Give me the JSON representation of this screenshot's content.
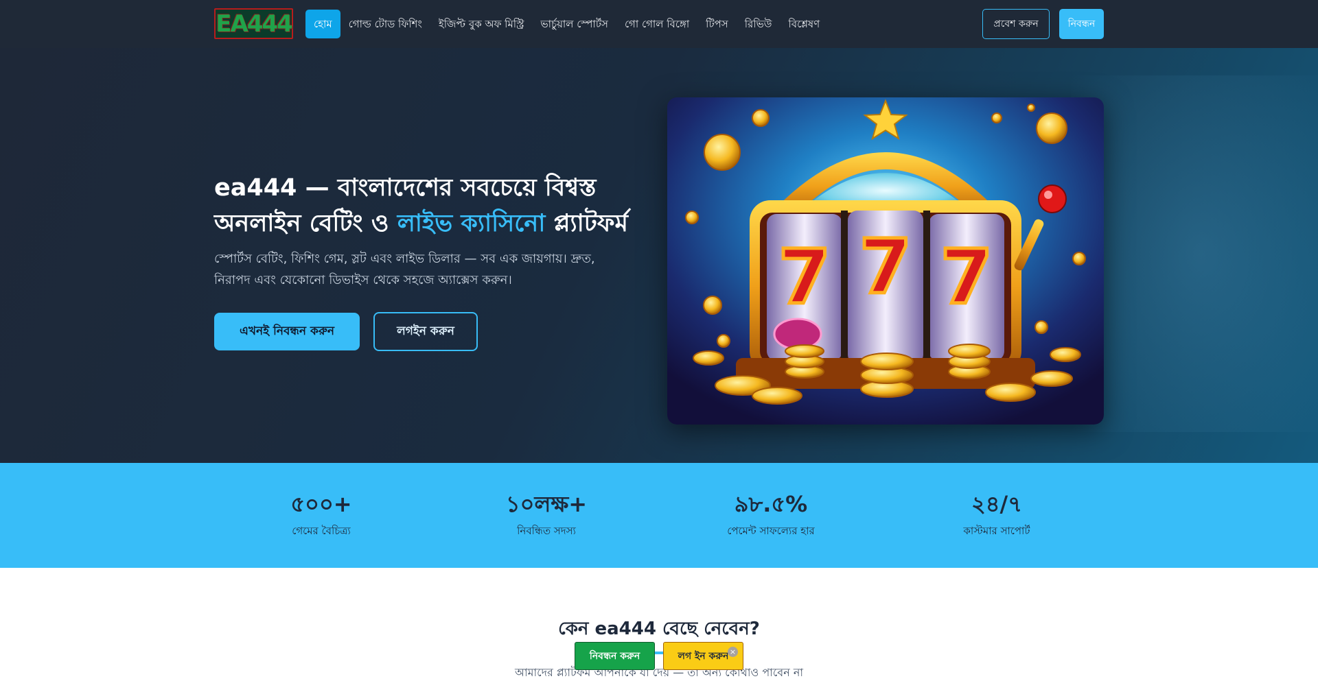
{
  "nav": {
    "logo_text": "EA444",
    "links": [
      {
        "label": "হোম",
        "active": true
      },
      {
        "label": "গোল্ড টোড ফিশিং",
        "active": false
      },
      {
        "label": "ইজিপ্ট বুক অফ মিস্ট্রি",
        "active": false
      },
      {
        "label": "ভার্চুয়াল স্পোর্টস",
        "active": false
      },
      {
        "label": "গো গোল বিঙ্গো",
        "active": false
      },
      {
        "label": "টিপস",
        "active": false
      },
      {
        "label": "রিভিউ",
        "active": false
      },
      {
        "label": "বিশ্লেষণ",
        "active": false
      }
    ],
    "login_label": "প্রবেশ করুন",
    "register_label": "নিবন্ধন"
  },
  "hero": {
    "title_part1": "ea444 — বাংলাদেশের সবচেয়ে বিশ্বস্ত অনলাইন বেটিং ও ",
    "title_accent": "লাইভ ক্যাসিনো",
    "title_part2": " প্ল্যাটফর্ম",
    "subtitle": "স্পোর্টস বেটিং, ফিশিং গেম, স্লট এবং লাইভ ডিলার — সব এক জায়গায়। দ্রুত, নিরাপদ এবং যেকোনো ডিভাইস থেকে সহজে অ্যাক্সেস করুন।",
    "primary_button": "এখনই নিবন্ধন করুন",
    "secondary_button": "লগইন করুন",
    "image_icon": "slot-machine-777-illustration"
  },
  "stats": [
    {
      "value": "৫০০+",
      "label": "গেমের বৈচিত্র্য"
    },
    {
      "value": "১০লক্ষ+",
      "label": "নিবন্ধিত সদস্য"
    },
    {
      "value": "৯৮.৫%",
      "label": "পেমেন্ট সাফল্যের হার"
    },
    {
      "value": "২৪/৭",
      "label": "কাস্টমার সাপোর্ট"
    }
  ],
  "why": {
    "title": "কেন ea444 বেছে নেবেন?",
    "subtitle": "আমাদের প্ল্যাটফর্ম আপনাকে যা দেয় — তা অন্য কোথাও পাবেন না"
  },
  "floating": {
    "register_label": "নিবন্ধন করুন",
    "login_label": "লগ ইন করুন",
    "close_symbol": "×"
  },
  "colors": {
    "accent": "#38bdf8",
    "nav_bg": "#1f2937",
    "float_register": "#16a34a",
    "float_login": "#facc15"
  }
}
